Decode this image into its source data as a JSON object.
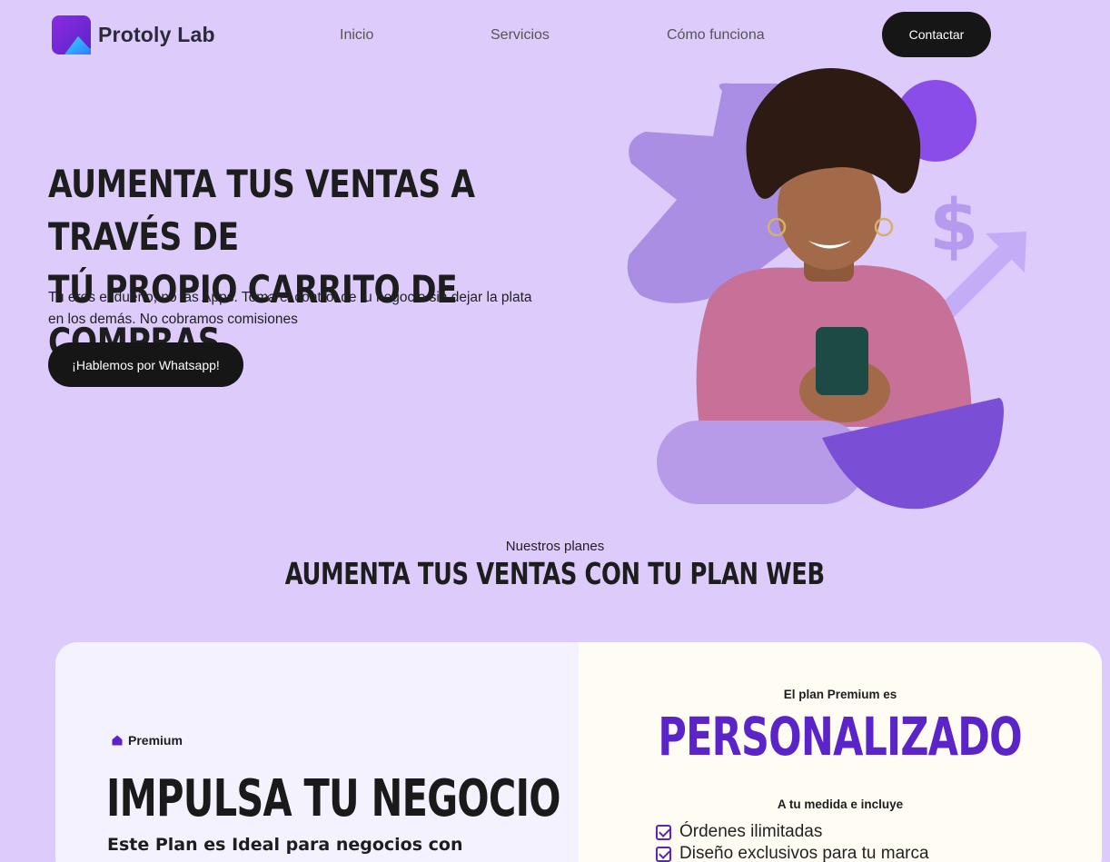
{
  "brand": {
    "name": "Protoly Lab"
  },
  "nav": {
    "items": [
      "Inicio",
      "Servicios",
      "Cómo funciona"
    ],
    "contact_label": "Contactar"
  },
  "hero": {
    "title_line1": "AUMENTA TUS VENTAS A TRAVÉS DE",
    "title_line2": "TÚ PROPIO CARRITO DE COMPRAS",
    "subtitle": "Tu eres el dueño, no las Apps. Toma el control de tu negocio sin dejar la plata en los demás. No cobramos comisiones",
    "cta_label": "¡Hablemos por Whatsapp!",
    "dollar_symbol": "$"
  },
  "plans": {
    "kicker": "Nuestros planes",
    "title": "AUMENTA TUS VENTAS CON TU PLAN WEB"
  },
  "plan_card": {
    "tag": "Premium",
    "headline": "IMPULSA TU NEGOCIO",
    "description_line1": "Este Plan es Ideal para negocios con",
    "description_line2": "",
    "right_kicker": "El plan Premium es",
    "right_big": "PERSONALIZADO",
    "includes_label": "A tu medida e incluye",
    "features": [
      "Órdenes ilimitadas",
      "Diseño exclusivos para tu marca"
    ]
  },
  "colors": {
    "background": "#dccbfb",
    "accent": "#5b24c9",
    "button": "#161616",
    "shape_light": "#a98ee3",
    "shape_dark": "#7a4fd6"
  }
}
